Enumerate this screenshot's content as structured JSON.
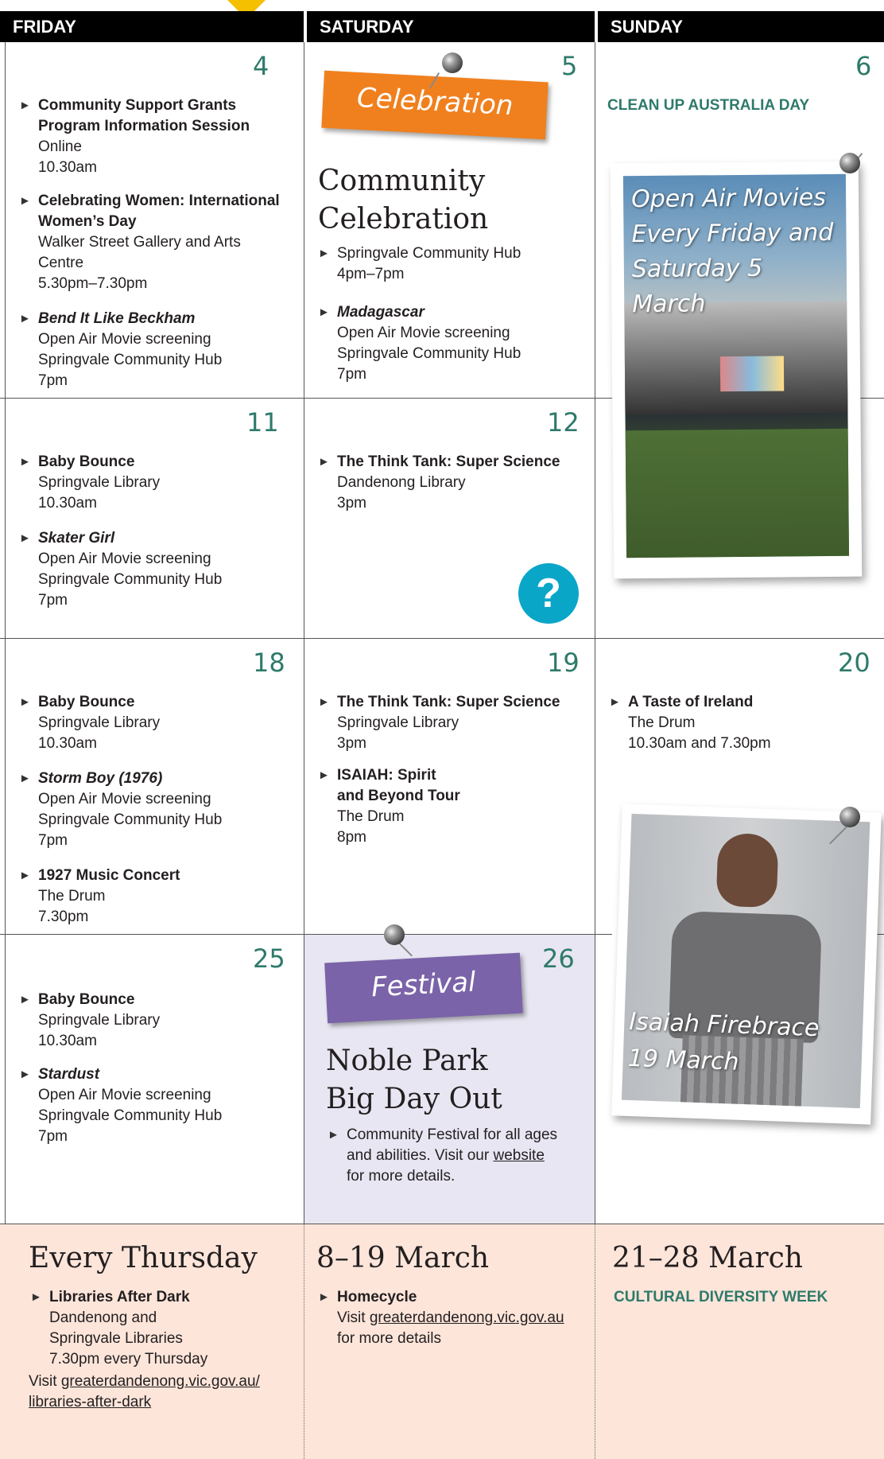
{
  "header": {
    "friday": "FRIDAY",
    "saturday": "SATURDAY",
    "sunday": "SUNDAY"
  },
  "days": {
    "fri4": "4",
    "sat5": "5",
    "sun6": "6",
    "fri11": "11",
    "sat12": "12",
    "fri18": "18",
    "sat19": "19",
    "sun20": "20",
    "fri25": "25",
    "sat26": "26"
  },
  "fri4": {
    "e1": {
      "title": "Community Support Grants Program Information Session",
      "l1": "Online",
      "l2": "10.30am"
    },
    "e2": {
      "title": "Celebrating Women: International Women’s Day",
      "l1": "Walker Street Gallery and Arts Centre",
      "l2": "5.30pm–7.30pm"
    },
    "e3": {
      "title": "Bend It Like Beckham",
      "l1": "Open Air Movie screening",
      "l2": "Springvale Community Hub",
      "l3": "7pm"
    }
  },
  "sat5": {
    "banner": "Celebration",
    "heading": "Community Celebration",
    "e1": {
      "l1": "Springvale Community Hub",
      "l2": "4pm–7pm"
    },
    "e2": {
      "title": "Madagascar",
      "l1": "Open Air Movie screening",
      "l2": "Springvale Community Hub",
      "l3": "7pm"
    }
  },
  "sun6": {
    "title": "CLEAN UP AUSTRALIA DAY",
    "poster_text": "Open Air Movies Every Friday and Saturday 5 March"
  },
  "fri11": {
    "e1": {
      "title": "Baby Bounce",
      "l1": "Springvale Library",
      "l2": "10.30am"
    },
    "e2": {
      "title": "Skater Girl",
      "l1": "Open Air Movie screening",
      "l2": "Springvale Community Hub",
      "l3": "7pm"
    }
  },
  "sat12": {
    "e1": {
      "title": "The Think Tank: Super Science",
      "l1": "Dandenong Library",
      "l2": "3pm"
    },
    "qmark": "?"
  },
  "fri18": {
    "e1": {
      "title": "Baby Bounce",
      "l1": "Springvale Library",
      "l2": "10.30am"
    },
    "e2": {
      "title": "Storm Boy (1976)",
      "l1": "Open Air Movie screening",
      "l2": "Springvale Community Hub",
      "l3": "7pm"
    },
    "e3": {
      "title": "1927 Music Concert",
      "l1": "The Drum",
      "l2": "7.30pm"
    }
  },
  "sat19": {
    "e1": {
      "title": "The Think Tank: Super Science",
      "l1": "Springvale Library",
      "l2": "3pm"
    },
    "e2": {
      "title1": "ISAIAH: Spirit",
      "title2": "and Beyond Tour",
      "l1": "The Drum",
      "l2": "8pm"
    }
  },
  "sun20": {
    "e1": {
      "title": "A Taste of Ireland",
      "l1": "The Drum",
      "l2": "10.30am and 7.30pm"
    },
    "photo_caption1": "Isaiah Firebrace",
    "photo_caption2": "19 March"
  },
  "fri25": {
    "e1": {
      "title": "Baby Bounce",
      "l1": "Springvale Library",
      "l2": "10.30am"
    },
    "e2": {
      "title": "Stardust",
      "l1": "Open Air Movie screening",
      "l2": "Springvale Community Hub",
      "l3": "7pm"
    }
  },
  "sat26": {
    "banner": "Festival",
    "heading1": "Noble Park",
    "heading2": "Big Day Out",
    "e1": {
      "l1": "Community Festival for all ages",
      "l2": "and abilities. Visit our",
      "link": "website ",
      "l3": "for more details."
    }
  },
  "footer": {
    "c1": {
      "heading": "Every Thursday",
      "title": "Libraries After Dark",
      "l1": "Dandenong and",
      "l2": "Springvale Libraries",
      "l3": "7.30pm every Thursday",
      "visit": "Visit ",
      "link1": "greaterdandenong.vic.gov.au/",
      "link2": "libraries-after-dark"
    },
    "c2": {
      "heading": "8–19 March",
      "title": "Homecycle",
      "visit": "Visit ",
      "link": "greaterdandenong.vic.gov.au",
      "l2": "for more details"
    },
    "c3": {
      "heading": "21–28 March",
      "title": "CULTURAL DIVERSITY WEEK"
    }
  },
  "colors": {
    "accent_green": "#2e7a6a",
    "orange": "#f0801e",
    "purple": "#7a63a8",
    "pink_bg": "#fde5da",
    "lavender_bg": "#e8e6f2",
    "cyan": "#0aa6c8"
  }
}
